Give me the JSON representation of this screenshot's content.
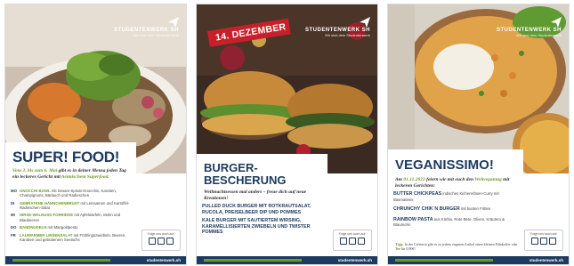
{
  "brand": {
    "name": "STUDENTENWERK SH",
    "tagline": "Wir sind dein Studentenwerk",
    "site": "studentenwerk.sh"
  },
  "social_label": "Folge uns auch auf:",
  "colors": {
    "navy": "#1d3a5f",
    "green": "#6f9a2a",
    "red": "#c8202a"
  },
  "poster1": {
    "title": "SUPER! FOOD!",
    "intro_dates": "Vom 2. bis zum 6. Mai",
    "intro_mid": " gibt es in deiner Mensa jeden Tag ein leckeres Gericht mit ",
    "intro_hl": "heimischem Superfood.",
    "items": [
      {
        "day": "MO",
        "name": "GNOCCHI BOWL",
        "desc": "mit Sesam-Spinat-Gnocchis, Karotten, Champignons, Bärlauch und Radieschen"
      },
      {
        "day": "DI",
        "name": "GEBRATENE HÄHNCHENBRUST",
        "desc": "mit Leinsamen und Kartoffel-Radieschen-Salat"
      },
      {
        "day": "MI",
        "name": "HIRSE-WALNUSS-FORRIDGE",
        "desc": "mit Apfelwürfeln, Mohn und Blaubeeren"
      },
      {
        "day": "DO",
        "name": "BANDNUDELN",
        "desc": "mit Mangoldpesto"
      },
      {
        "day": "FR",
        "name": "LAUWARMER LINSENSALAT",
        "desc": "mit Frühlingszwiebeln, Beeren, Karotten und gebratenem Seelachs"
      }
    ]
  },
  "poster2": {
    "ribbon": "14. DEZEMBER",
    "title_line1": "BURGER-",
    "title_line2": "BESCHERUNG",
    "intro": "Weihnachtsessen mal anders – freue dich auf neue Kreationen!",
    "items": [
      {
        "name": "PULLED DUCK BURGER MIT ROTKRAUTSALAT, RUCOLA, PREISELBEER DIP UND POMMES"
      },
      {
        "name": "KALE BURGER MIT SAUTIERTEM WIRSING, KARAMELLISIERTEN ZWIEBELN UND TWISTER POMMES"
      }
    ]
  },
  "poster3": {
    "title": "VEGANISSIMO!",
    "intro_a": "Am ",
    "intro_date": "01.11.2022",
    "intro_b": " feiern wir mit euch den ",
    "intro_hl": "Weltvegantag",
    "intro_c": " mit leckeren Gerichten:",
    "items": [
      {
        "name": "BUTTER CHICKPEAS",
        "desc": "indisches Kichererbsen-Curry mit Basmatireis"
      },
      {
        "name": "CHRUNCHY CHIK`N BURGER",
        "desc": "mit bunten Fritten"
      },
      {
        "name": "RAINBOW PASTA",
        "desc": "aus Kürbis, Rote Bete, Oliven, Kräutern & Blaumohn"
      }
    ],
    "tip_label": "Tipp:",
    "tip": "In der Cafeteria gibt es zu jedem veganen Artikel einen kleinen Fährkoffer oder Tee für 0,90€!"
  }
}
